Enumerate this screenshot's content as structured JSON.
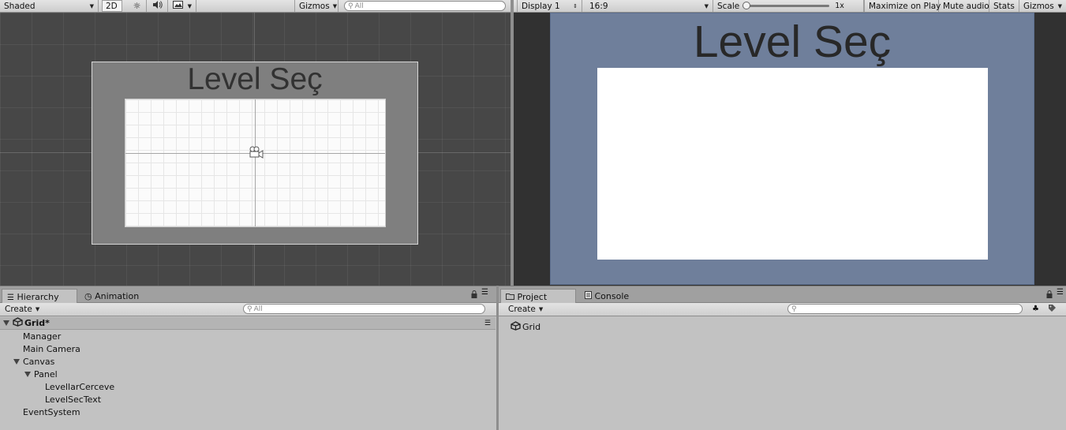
{
  "scene_toolbar": {
    "shading_mode": "Shaded",
    "mode_2d": "2D",
    "gizmos": "Gizmos",
    "search_placeholder": "All"
  },
  "game_toolbar": {
    "display": "Display 1",
    "aspect": "16:9",
    "scale_label": "Scale",
    "scale_value": "1x",
    "scale_level": 0,
    "maximize_on_play": "Maximize on Play",
    "mute_audio": "Mute audio",
    "stats": "Stats",
    "gizmos": "Gizmos"
  },
  "scene_view": {
    "canvas_title": "Level Seç"
  },
  "game_view": {
    "canvas_title": "Level Seç",
    "background_color": "#6f7f9b"
  },
  "left_tabs": {
    "hierarchy": "Hierarchy",
    "animation": "Animation"
  },
  "right_tabs": {
    "project": "Project",
    "console": "Console"
  },
  "hierarchy": {
    "create_label": "Create",
    "search_placeholder": "All",
    "scene_name": "Grid*",
    "items": [
      {
        "label": "Manager"
      },
      {
        "label": "Main Camera"
      },
      {
        "label": "Canvas"
      },
      {
        "label": "Panel"
      },
      {
        "label": "LevellarCerceve"
      },
      {
        "label": "LevelSecText"
      },
      {
        "label": "EventSystem"
      }
    ]
  },
  "project": {
    "create_label": "Create",
    "items": [
      {
        "label": "Grid"
      }
    ]
  }
}
